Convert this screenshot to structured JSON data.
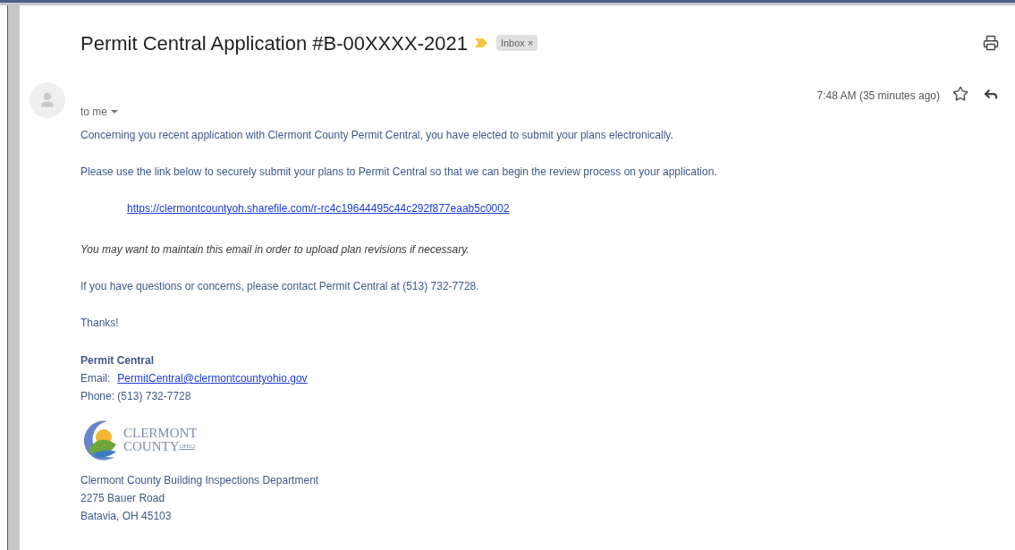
{
  "subject": "Permit Central Application #B-00XXXX-2021",
  "label": {
    "text": "Inbox",
    "close": "×"
  },
  "recipient": "to me",
  "time": "7:48 AM (35 minutes ago)",
  "starred": false,
  "body": [
    {
      "kind": "text",
      "text": "Concerning you recent application with Clermont County Permit Central, you have elected to submit your plans electronically."
    },
    {
      "kind": "text",
      "text": "Please use the link below to securely submit your plans to Permit Central so that we can begin the review process on your application."
    },
    {
      "kind": "link",
      "text": "https://clermontcountyoh.sharefile.com/r-rc4c19644495c44c292f877eaab5c0002"
    },
    {
      "kind": "italic",
      "text": "You may want to maintain this email in order to upload plan revisions if necessary."
    },
    {
      "kind": "text",
      "text": "If you have questions or concerns, please contact Permit Central at (513) 732-7728."
    },
    {
      "kind": "text",
      "text": "Thanks!"
    }
  ],
  "signature": {
    "name": "Permit Central",
    "email_label": "Email:",
    "email": "PermitCentral@clermontcountyohio.gov",
    "phone": "Phone: (513) 732-7728",
    "logo": {
      "line1": "CLERMONT",
      "line2": "COUNTY",
      "suffix": "OHIO"
    },
    "address": [
      "Clermont County Building Inspections Department",
      "2275 Bauer Road",
      "Batavia, OH 45103"
    ]
  }
}
